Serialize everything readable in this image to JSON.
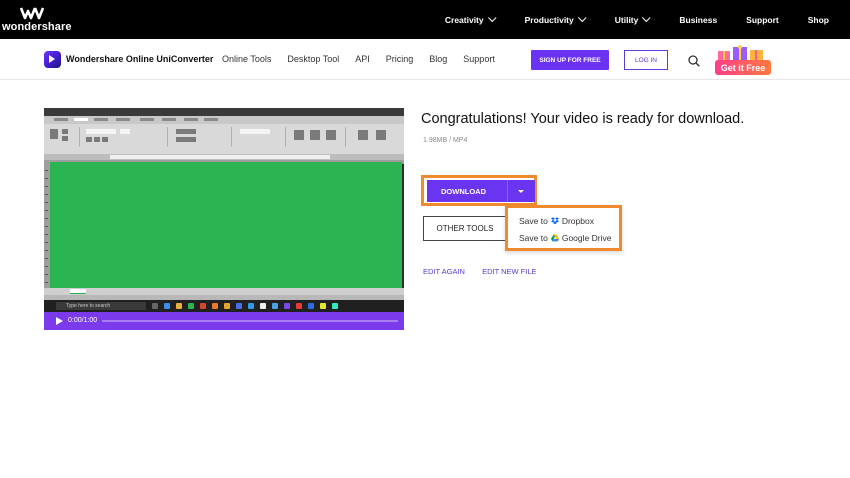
{
  "topbar": {
    "brand": "wondershare",
    "nav": [
      {
        "label": "Creativity",
        "has_dropdown": true
      },
      {
        "label": "Productivity",
        "has_dropdown": true
      },
      {
        "label": "Utility",
        "has_dropdown": true
      },
      {
        "label": "Business",
        "has_dropdown": false
      },
      {
        "label": "Support",
        "has_dropdown": false
      },
      {
        "label": "Shop",
        "has_dropdown": false
      }
    ]
  },
  "product_header": {
    "name": "Wondershare Online UniConverter",
    "nav": [
      "Online Tools",
      "Desktop Tool",
      "API",
      "Pricing",
      "Blog",
      "Support"
    ],
    "signup_label": "SIGN UP FOR FREE",
    "login_label": "LOG IN",
    "promo_label": "Get it Free"
  },
  "video": {
    "taskbar_search": "Type here to search",
    "current_time": "0:00",
    "duration": "1:00",
    "time_display": "0:00/1:00",
    "progress": 0
  },
  "result": {
    "headline": "Congratulations! Your video is ready for download.",
    "meta": "1.98MB / MP4",
    "download_label": "DOWNLOAD",
    "other_tools_label": "OTHER TOOLS",
    "edit_again_label": "EDIT AGAIN",
    "edit_new_file_label": "EDIT NEW FILE"
  },
  "download_menu": {
    "items": [
      {
        "prefix": "Save to",
        "service": "Dropbox",
        "icon": "dropbox-icon"
      },
      {
        "prefix": "Save to",
        "service": "Google Drive",
        "icon": "google-drive-icon"
      }
    ]
  },
  "colors": {
    "accent": "#6b34f0",
    "highlight": "#f08a2c",
    "video_green": "#2bb452",
    "link": "#5a3ad8"
  }
}
